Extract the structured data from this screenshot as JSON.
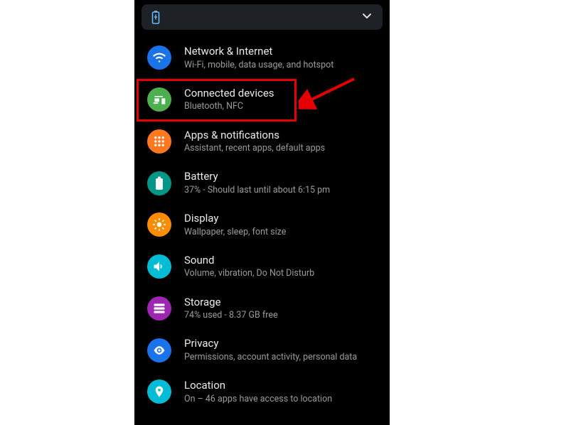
{
  "banner": {
    "icon": "battery",
    "chevron": "▾"
  },
  "settings": [
    {
      "id": "network",
      "title": "Network & Internet",
      "sub": "Wi-Fi, mobile, data usage, and hotspot",
      "color": "#1a73e8",
      "icon": "wifi"
    },
    {
      "id": "connected",
      "title": "Connected devices",
      "sub": "Bluetooth, NFC",
      "color": "#4caf50",
      "icon": "devices"
    },
    {
      "id": "apps",
      "title": "Apps & notifications",
      "sub": "Assistant, recent apps, default apps",
      "color": "#ff7820",
      "icon": "apps"
    },
    {
      "id": "battery",
      "title": "Battery",
      "sub": "37% - Should last until about 6:15 pm",
      "color": "#009688",
      "icon": "battery"
    },
    {
      "id": "display",
      "title": "Display",
      "sub": "Wallpaper, sleep, font size",
      "color": "#fb8c00",
      "icon": "display"
    },
    {
      "id": "sound",
      "title": "Sound",
      "sub": "Volume, vibration, Do Not Disturb",
      "color": "#00bcd4",
      "icon": "sound"
    },
    {
      "id": "storage",
      "title": "Storage",
      "sub": "74% used - 8.37 GB free",
      "color": "#9c27b0",
      "icon": "storage"
    },
    {
      "id": "privacy",
      "title": "Privacy",
      "sub": "Permissions, account activity, personal data",
      "color": "#1a73e8",
      "icon": "privacy"
    },
    {
      "id": "location",
      "title": "Location",
      "sub": "On – 46 apps have access to location",
      "color": "#00bcd4",
      "icon": "location"
    }
  ],
  "annotation": {
    "highlighted_item": "connected",
    "arrow_target": "connected"
  }
}
